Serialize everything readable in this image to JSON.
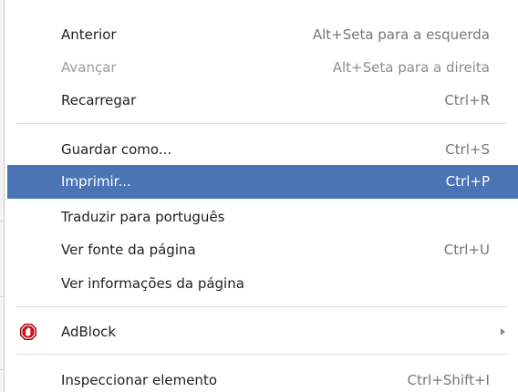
{
  "menu": {
    "items": [
      {
        "label": "Anterior",
        "shortcut": "Alt+Seta para a esquerda",
        "enabled": true
      },
      {
        "label": "Avançar",
        "shortcut": "Alt+Seta para a direita",
        "enabled": false
      },
      {
        "label": "Recarregar",
        "shortcut": "Ctrl+R",
        "enabled": true
      },
      {
        "label": "Guardar como...",
        "shortcut": "Ctrl+S",
        "enabled": true
      },
      {
        "label": "Imprimir...",
        "shortcut": "Ctrl+P",
        "enabled": true,
        "selected": true
      },
      {
        "label": "Traduzir para português",
        "shortcut": "",
        "enabled": true
      },
      {
        "label": "Ver fonte da página",
        "shortcut": "Ctrl+U",
        "enabled": true
      },
      {
        "label": "Ver informações da página",
        "shortcut": "",
        "enabled": true
      },
      {
        "label": "AdBlock",
        "shortcut": "",
        "enabled": true,
        "icon": "adblock-icon",
        "submenu": true
      },
      {
        "label": "Inspeccionar elemento",
        "shortcut": "Ctrl+Shift+I",
        "enabled": true
      }
    ]
  },
  "colors": {
    "selected_background": "#4a74b3",
    "adblock_red": "#c8141c"
  }
}
